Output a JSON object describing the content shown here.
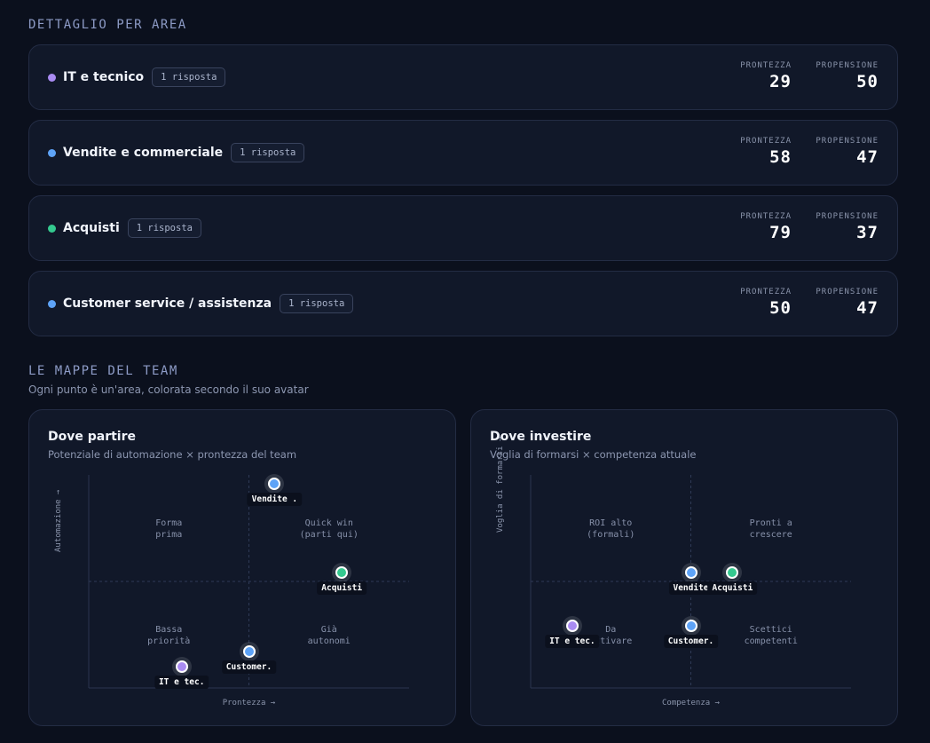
{
  "detail": {
    "title": "DETTAGLIO PER AREA",
    "metric_labels": {
      "readiness": "PRONTEZZA",
      "propensity": "PROPENSIONE"
    },
    "areas": [
      {
        "name": "IT e tecnico",
        "badge": "1 risposta",
        "readiness": "29",
        "propensity": "50",
        "color": "#a98bf2"
      },
      {
        "name": "Vendite e commerciale",
        "badge": "1 risposta",
        "readiness": "58",
        "propensity": "47",
        "color": "#5ea3f7"
      },
      {
        "name": "Acquisti",
        "badge": "1 risposta",
        "readiness": "79",
        "propensity": "37",
        "color": "#34c98f"
      },
      {
        "name": "Customer service / assistenza",
        "badge": "1 risposta",
        "readiness": "50",
        "propensity": "47",
        "color": "#5ea3f7"
      }
    ]
  },
  "maps": {
    "title": "LE MAPPE DEL TEAM",
    "subtitle": "Ogni punto è un'area, colorata secondo il suo avatar",
    "cards": [
      {
        "title": "Dove partire",
        "subtitle": "Potenziale di automazione × prontezza del team",
        "xlabel": "Prontezza →",
        "ylabel": "Automazione →",
        "quadrants": {
          "top_left": "Forma\nprima",
          "top_right": "Quick win\n(parti qui)",
          "bottom_left": "Bassa\npriorità",
          "bottom_right": "Già\nautonomi"
        },
        "points": [
          {
            "label": "Vendite .",
            "x": 58,
            "y": 96,
            "color": "#5ea3f7"
          },
          {
            "label": "Acquisti",
            "x": 79,
            "y": 54,
            "color": "#34c98f"
          },
          {
            "label": "Customer.",
            "x": 50,
            "y": 17,
            "color": "#5ea3f7"
          },
          {
            "label": "IT e tec.",
            "x": 29,
            "y": 10,
            "color": "#a98bf2"
          }
        ]
      },
      {
        "title": "Dove investire",
        "subtitle": "Voglia di formarsi × competenza attuale",
        "xlabel": "Competenza →",
        "ylabel": "Voglia di formarsi →",
        "quadrants": {
          "top_left": "ROI alto\n(formali)",
          "top_right": "Pronti a\ncrescere",
          "bottom_left": "Da\nattivare",
          "bottom_right": "Scettici\ncompetenti"
        },
        "points": [
          {
            "label": "Vendite",
            "x": 50,
            "y": 54,
            "color": "#5ea3f7"
          },
          {
            "label": "Acquisti",
            "x": 63,
            "y": 54,
            "color": "#34c98f"
          },
          {
            "label": "IT e tec.",
            "x": 13,
            "y": 29,
            "color": "#a98bf2"
          },
          {
            "label": "Customer.",
            "x": 50,
            "y": 29,
            "color": "#5ea3f7"
          }
        ]
      }
    ]
  }
}
